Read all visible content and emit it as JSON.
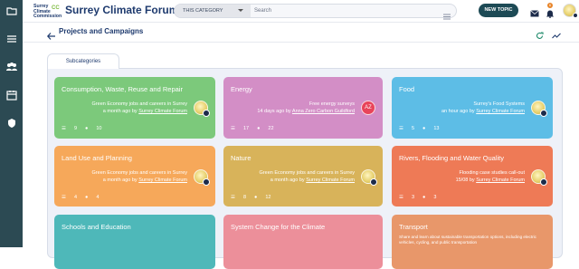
{
  "rail": {
    "items": [
      "folder-icon",
      "list-icon",
      "users-icon",
      "calendar-icon",
      "shield-icon"
    ]
  },
  "header": {
    "logo_lines": [
      "Surrey",
      "Climate",
      "Commission"
    ],
    "logo_mark": "CC",
    "forum_title": "Surrey Climate Forum",
    "category_select": "THIS CATEGORY",
    "search_placeholder": "Search",
    "new_topic": "NEW TOPIC",
    "notification_count": "6"
  },
  "page": {
    "title": "Projects and Campaigns"
  },
  "tabs": {
    "subcategories": "Subcategories"
  },
  "colors": {
    "rail": "#2c4a53",
    "accent": "#1d4a55",
    "badge": "#e8852a"
  },
  "cards": [
    {
      "title": "Consumption, Waste, Reuse and Repair",
      "line1": "Green Economy jobs and careers in Surrey",
      "line2_prefix": "a month ago by ",
      "line2_user": "Surrey Climate Forum",
      "topics": "9",
      "posts": "10",
      "color": "#7cc97b"
    },
    {
      "title": "Energy",
      "line1": "Free energy surveys",
      "line2_prefix": "14 days ago by ",
      "line2_user": "Anna Zero Carbon Guildford",
      "avatar_text": "AZ",
      "topics": "17",
      "posts": "22",
      "color": "#d38ec6"
    },
    {
      "title": "Food",
      "line1": "Surrey's Food Systems",
      "line2_prefix": "an hour ago by ",
      "line2_user": "Surrey Climate Forum",
      "topics": "5",
      "posts": "13",
      "color": "#5dbde6"
    },
    {
      "title": "Land Use and Planning",
      "line1": "Green Economy jobs and careers in Surrey",
      "line2_prefix": "a month ago by ",
      "line2_user": "Surrey Climate Forum",
      "topics": "4",
      "posts": "4",
      "color": "#f6a85a"
    },
    {
      "title": "Nature",
      "line1": "Green Economy jobs and careers in Surrey",
      "line2_prefix": "a month ago by ",
      "line2_user": "Surrey Climate Forum",
      "topics": "8",
      "posts": "12",
      "color": "#d8b35a"
    },
    {
      "title": "Rivers, Flooding and Water Quality",
      "line1": "Flooding case studies call-out",
      "line2_prefix": "15/08 by ",
      "line2_user": "Surrey Climate Forum",
      "topics": "3",
      "posts": "3",
      "color": "#ee7a56"
    },
    {
      "title": "Schools and Education",
      "color": "#4eb8b9"
    },
    {
      "title": "System Change for the Climate",
      "color": "#ec8f9a"
    },
    {
      "title": "Transport",
      "desc": "Share and learn about sustainable transportation options, including electric vehicles, cycling, and public transportation",
      "color": "#e8976a"
    }
  ]
}
